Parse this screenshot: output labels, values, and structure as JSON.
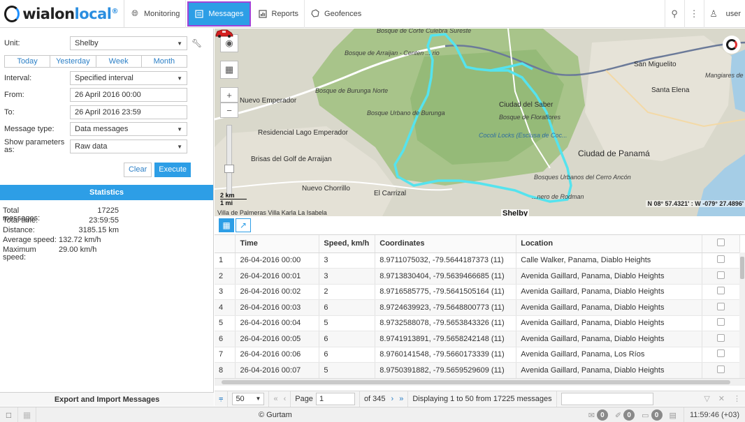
{
  "brand": {
    "name_a": "wialon",
    "name_b": "local"
  },
  "nav": {
    "monitoring": "Monitoring",
    "messages": "Messages",
    "reports": "Reports",
    "geofences": "Geofences",
    "user": "user"
  },
  "form": {
    "unit_label": "Unit:",
    "unit_value": "Shelby",
    "day_tabs": [
      "Today",
      "Yesterday",
      "Week",
      "Month"
    ],
    "interval_label": "Interval:",
    "interval_value": "Specified interval",
    "from_label": "From:",
    "from_value": "26 April 2016 00:00",
    "to_label": "To:",
    "to_value": "26 April 2016 23:59",
    "msgtype_label": "Message type:",
    "msgtype_value": "Data messages",
    "params_label": "Show parameters as:",
    "params_value": "Raw data",
    "clear": "Clear",
    "execute": "Execute"
  },
  "statistics": {
    "title": "Statistics",
    "rows": [
      {
        "label": "Total messages:",
        "value": "17225"
      },
      {
        "label": "Total time:",
        "value": "23:59:55"
      },
      {
        "label": "Distance:",
        "value": "3185.15 km"
      },
      {
        "label": "Average speed:",
        "value": "132.72 km/h"
      },
      {
        "label": "Maximum speed:",
        "value": "29.00 km/h"
      }
    ]
  },
  "export_label": "Export and Import Messages",
  "map": {
    "labels": {
      "corte": "Bosque de Corte Culebra Sureste",
      "arraijan": "Bosque de Arraijan - Centen ... rio",
      "san_miguelito": "San Miguelito",
      "mangiares": "Mangiares de C",
      "burunga_norte": "Bosque de Burunga Norte",
      "nuevo_emperador": "Nuevo Emperador",
      "santa_elena": "Santa Elena",
      "urbano": "Bosque Urbano de Burunga",
      "ciudad_saber": "Ciudad del Saber",
      "floraflores": "Bosque de Floraflores",
      "cocoli": "Cocoli Locks (Esclusa de Coc...",
      "residencial": "Residencial Lago Emperador",
      "ciudad_panama": "Ciudad de Panamá",
      "brisas": "Brisas del Golf de Arraijan",
      "cerro_ancon": "Bosques Urbanos del Cerro Ancón",
      "nuevo_chorrillo": "Nuevo Chorrillo",
      "el_carrizal": "El Carrizal",
      "rodman": "...nero de Rodman",
      "villa": "Villa de Palmeras   Villa Karla   La Isabela"
    },
    "scale_km": "2 km",
    "scale_mi": "1 mi",
    "coords": "N 08° 57.4321' : W -079° 27.4896'",
    "unit_marker": "Shelby",
    "track_color": "#55e3ee"
  },
  "table": {
    "headers": [
      "",
      "Time",
      "Speed, km/h",
      "Coordinates",
      "Location",
      ""
    ],
    "rows": [
      [
        "1",
        "26-04-2016 00:00",
        "3",
        "8.9711075032, -79.5644187373 (11)",
        "Calle Walker, Panama, Diablo Heights"
      ],
      [
        "2",
        "26-04-2016 00:01",
        "3",
        "8.9713830404, -79.5639466685 (11)",
        "Avenida Gaillard, Panama, Diablo Heights"
      ],
      [
        "3",
        "26-04-2016 00:02",
        "2",
        "8.9716585775, -79.5641505164 (11)",
        "Avenida Gaillard, Panama, Diablo Heights"
      ],
      [
        "4",
        "26-04-2016 00:03",
        "6",
        "8.9724639923, -79.5648800773 (11)",
        "Avenida Gaillard, Panama, Diablo Heights"
      ],
      [
        "5",
        "26-04-2016 00:04",
        "5",
        "8.9732588078, -79.5653843326 (11)",
        "Avenida Gaillard, Panama, Diablo Heights"
      ],
      [
        "6",
        "26-04-2016 00:05",
        "6",
        "8.9741913891, -79.5658242148 (11)",
        "Avenida Gaillard, Panama, Diablo Heights"
      ],
      [
        "7",
        "26-04-2016 00:06",
        "6",
        "8.9760141548, -79.5660173339 (11)",
        "Avenida Gaillard, Panama, Los Ríos"
      ],
      [
        "8",
        "26-04-2016 00:07",
        "5",
        "8.9750391882, -79.5659529609 (11)",
        "Avenida Gaillard, Panama, Diablo Heights"
      ]
    ]
  },
  "pager": {
    "per_page": "50",
    "page_label": "Page",
    "page_value": "1",
    "of_label": "of 345",
    "displaying": "Displaying 1 to 50 from 17225 messages"
  },
  "footer": {
    "copyright": "© Gurtam",
    "counters": [
      "0",
      "0",
      "0"
    ],
    "clock": "11:59:46 (+03)"
  },
  "colors": {
    "accent": "#2d9ee6",
    "highlight": "#a142d8"
  }
}
